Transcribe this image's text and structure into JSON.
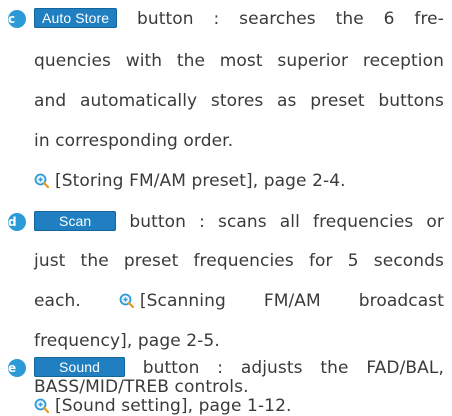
{
  "items": [
    {
      "letter": "c",
      "button_label": "Auto Store",
      "line1_rest": "button : searches the 6 fre-",
      "line2": "quencies with the most superior reception",
      "line3": "and automatically stores as preset buttons",
      "line4": "in corresponding order.",
      "reference": "[Storing FM/AM preset], page 2-4."
    },
    {
      "letter": "d",
      "button_label": "Scan",
      "line1_rest": "button : scans all frequencies or",
      "line2": "just the preset frequencies for 5 seconds",
      "line3_before": "each.",
      "line3_after": "[Scanning FM/AM broadcast",
      "line4": "frequency], page 2-5."
    },
    {
      "letter": "e",
      "button_label": "Sound",
      "line1_rest": "button : adjusts the FAD/BAL,",
      "line2": "BASS/MID/TREB controls.",
      "reference": "[Sound setting], page 1-12."
    }
  ],
  "colors": {
    "accent": "#2d9ad8",
    "button": "#1f7fc0",
    "text": "#3a3a3a"
  },
  "icons": {
    "bullet": "circled-letter",
    "reference": "magnifier-reference-icon"
  }
}
